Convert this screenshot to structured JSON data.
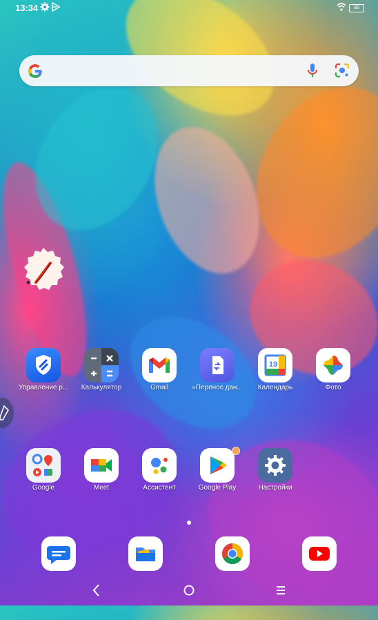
{
  "status_bar": {
    "time": "13:34",
    "battery": "85"
  },
  "search_bar": {
    "google_icon": "google-g-icon",
    "mic_icon": "microphone-icon",
    "lens_icon": "google-lens-icon"
  },
  "widget": {
    "icon": "pen-widget-icon"
  },
  "apps_row1": [
    {
      "label": "Управление р...",
      "icon": "shield-manage-icon"
    },
    {
      "label": "Калькулятор",
      "icon": "calculator-icon"
    },
    {
      "label": "Gmail",
      "icon": "gmail-icon"
    },
    {
      "label": "«Перенос дан...",
      "icon": "data-transfer-icon"
    },
    {
      "label": "Календарь",
      "icon": "calendar-icon",
      "day": "19"
    },
    {
      "label": "Фото",
      "icon": "photos-icon"
    }
  ],
  "apps_row2": [
    {
      "label": "Google",
      "icon": "google-folder-icon"
    },
    {
      "label": "Meet",
      "icon": "meet-icon"
    },
    {
      "label": "Ассистент",
      "icon": "assistant-icon"
    },
    {
      "label": "Google Play",
      "icon": "google-play-icon"
    },
    {
      "label": "Настройки",
      "icon": "settings-icon"
    }
  ],
  "dock": [
    {
      "icon": "messages-icon"
    },
    {
      "icon": "files-icon"
    },
    {
      "icon": "chrome-icon"
    },
    {
      "icon": "youtube-icon"
    }
  ],
  "nav_bar": {
    "back": "back-icon",
    "home": "home-icon",
    "recents": "recents-icon"
  }
}
